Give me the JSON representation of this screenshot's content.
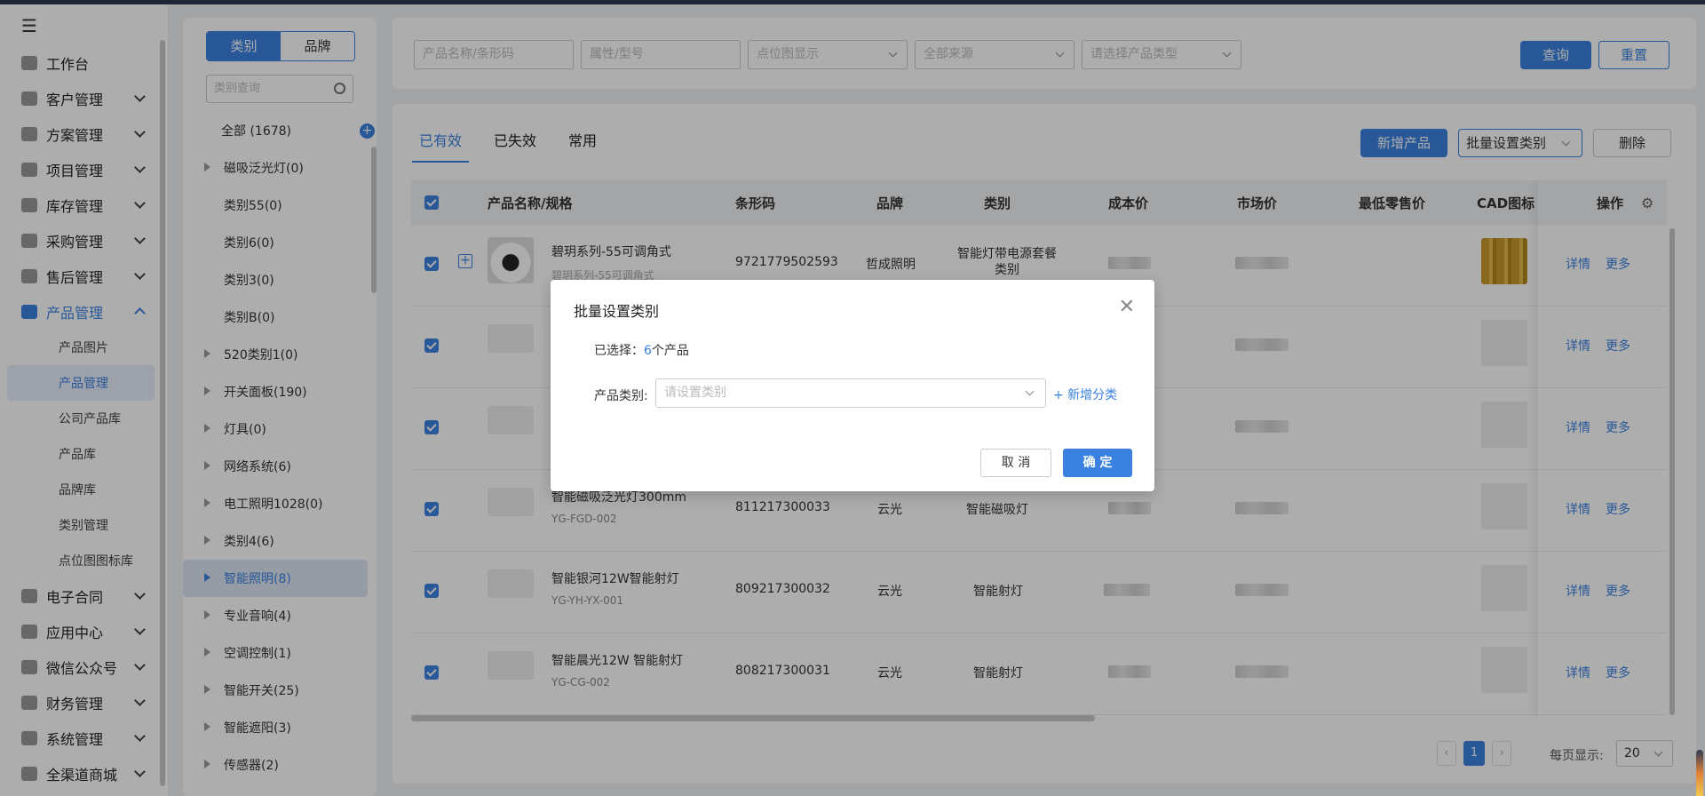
{
  "sidebar": {
    "items": [
      {
        "label": "工作台",
        "icon": "home-icon"
      },
      {
        "label": "客户管理",
        "icon": "customer-icon"
      },
      {
        "label": "方案管理",
        "icon": "plan-icon"
      },
      {
        "label": "项目管理",
        "icon": "folder-icon"
      },
      {
        "label": "库存管理",
        "icon": "inventory-icon"
      },
      {
        "label": "采购管理",
        "icon": "cart-icon"
      },
      {
        "label": "售后管理",
        "icon": "headset-icon"
      },
      {
        "label": "产品管理",
        "icon": "product-icon"
      }
    ],
    "sub_items": [
      "产品图片",
      "产品管理",
      "公司产品库",
      "产品库",
      "品牌库",
      "类别管理",
      "点位图图标库"
    ],
    "items_after": [
      {
        "label": "电子合同",
        "icon": "contract-icon"
      },
      {
        "label": "应用中心",
        "icon": "apps-icon"
      },
      {
        "label": "微信公众号",
        "icon": "wechat-icon"
      },
      {
        "label": "财务管理",
        "icon": "finance-icon"
      },
      {
        "label": "系统管理",
        "icon": "settings-icon"
      },
      {
        "label": "全渠道商城",
        "icon": "mall-icon"
      }
    ]
  },
  "category_panel": {
    "tabs": [
      "类别",
      "品牌"
    ],
    "search_placeholder": "类别查询",
    "items": [
      "全部 (1678)",
      "磁吸泛光灯(0)",
      "类别55(0)",
      "类别6(0)",
      "类别3(0)",
      "类别B(0)",
      "520类别1(0)",
      "开关面板(190)",
      "灯具(0)",
      "网络系统(6)",
      "电工照明1028(0)",
      "类别4(6)",
      "智能照明(8)",
      "专业音响(4)",
      "空调控制(1)",
      "智能开关(25)",
      "智能遮阳(3)",
      "传感器(2)"
    ]
  },
  "filters": {
    "name_placeholder": "产品名称/条形码",
    "attr_placeholder": "属性/型号",
    "display_placeholder": "点位图显示",
    "source_placeholder": "全部来源",
    "type_placeholder": "请选择产品类型",
    "query_label": "查询",
    "reset_label": "重置"
  },
  "main": {
    "tabs": [
      "已有效",
      "已失效",
      "常用"
    ],
    "add_label": "新增产品",
    "batch_label": "批量设置类别",
    "delete_label": "删除"
  },
  "table": {
    "headers": {
      "name": "产品名称/规格",
      "barcode": "条形码",
      "brand": "品牌",
      "category": "类别",
      "cost": "成本价",
      "market": "市场价",
      "min_retail": "最低零售价",
      "cad": "CAD图标",
      "ops": "操作"
    },
    "rows": [
      {
        "name": "碧玥系列-55可调角式",
        "code": "碧玥系列-55可调角式",
        "barcode": "9721779502593",
        "brand": "哲成照明",
        "category": "智能灯带电源套餐类别"
      },
      {
        "name": "",
        "code": "",
        "barcode": "",
        "brand": "",
        "category": ""
      },
      {
        "name": "",
        "code": "",
        "barcode": "",
        "brand": "",
        "category": ""
      },
      {
        "name": "智能磁吸泛光灯300mm",
        "code": "YG-FGD-002",
        "barcode": "811217300033",
        "brand": "云光",
        "category": "智能磁吸灯"
      },
      {
        "name": "智能银河12W智能射灯",
        "code": "YG-YH-YX-001",
        "barcode": "809217300032",
        "brand": "云光",
        "category": "智能射灯"
      },
      {
        "name": "智能晨光12W 智能射灯",
        "code": "YG-CG-002",
        "barcode": "808217300031",
        "brand": "云光",
        "category": "智能射灯"
      }
    ],
    "detail_label": "详情",
    "more_label": "更多"
  },
  "pagination": {
    "current": "1",
    "per_page_label": "每页显示:",
    "per_page_value": "20"
  },
  "modal": {
    "title": "批量设置类别",
    "selected_prefix": "已选择：",
    "selected_count": "6",
    "selected_suffix": "个产品",
    "category_label": "产品类别:",
    "category_placeholder": "请设置类别",
    "add_category": "+ 新增分类",
    "cancel": "取 消",
    "confirm": "确 定"
  },
  "colors": {
    "accent": "#3b82e0",
    "topbar": "#2c3a52"
  }
}
